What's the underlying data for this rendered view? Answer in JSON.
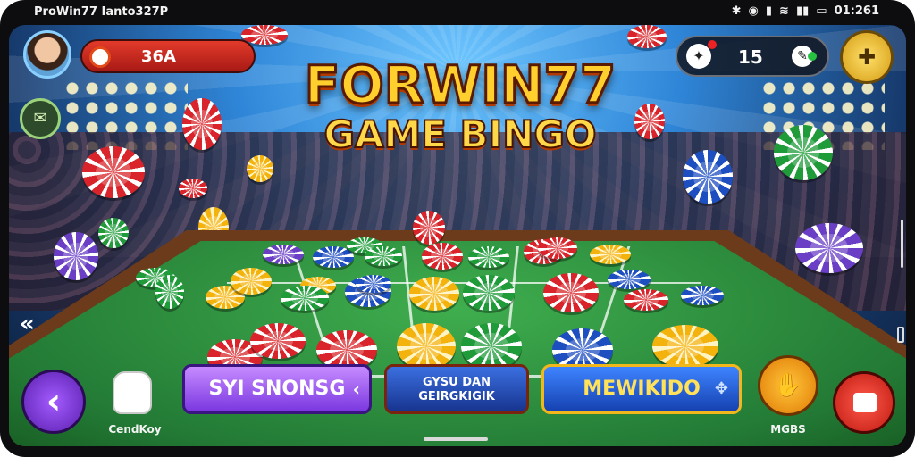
{
  "status_bar": {
    "title": "ProWin77 Ιanto327P",
    "time": "01:261"
  },
  "game": {
    "title_line1": "FORWIN77",
    "title_line2": "GAME BINGO"
  },
  "player": {
    "coins": "36A"
  },
  "top_right": {
    "count": "15"
  },
  "buttons": {
    "button1": "SYI SNONSG",
    "button2_line1": "GYSU DAN",
    "button2_line2": "GEIRGKIGIK",
    "button3": "MEWIKIDO"
  },
  "labels": {
    "mascot": "CendKoy",
    "menu": "MGBS"
  },
  "colors": {
    "felt": "#237a35",
    "rail": "#6b3b1b",
    "title": "#ffcf2e"
  }
}
